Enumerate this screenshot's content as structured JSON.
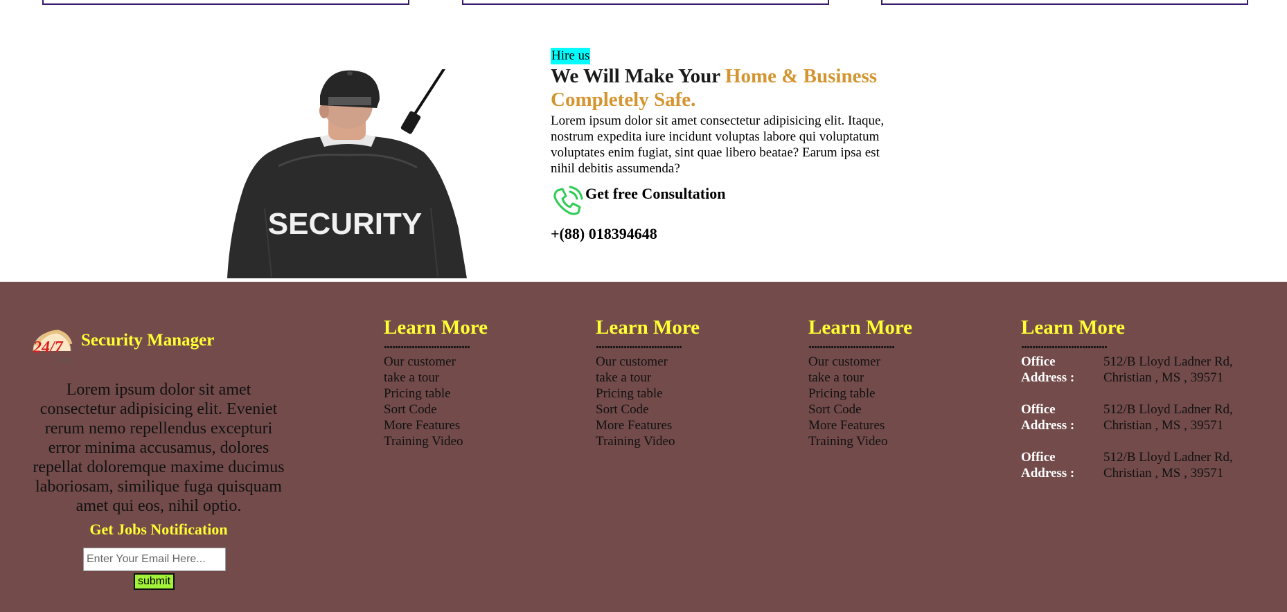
{
  "hire": {
    "tag": "Hire us",
    "title_part1": "We Will Make Your ",
    "title_accent": "Home & Business Completely Safe.",
    "text": "Lorem ipsum dolor sit amet consectetur adipisicing elit. Itaque, nostrum expedita iure incidunt voluptas labore qui voluptatum voluptates enim fugiat, sint quae libero beatae? Earum ipsa est nihil debitis assumenda?",
    "consult_label": "Get free Consultation",
    "phone": "+(88) 018394648",
    "image_text": "SECURITY"
  },
  "footer": {
    "brand_name": "Security Manager",
    "brand_logo_text": "24/7",
    "brand_text": "Lorem ipsum dolor sit amet consectetur adipisicing elit. Eveniet rerum nemo repellendus excepturi error minima accusamus, dolores repellat doloremque maxime ducimus laboriosam, similique fuga quisquam amet qui eos, nihil optio.",
    "jobs_title": "Get Jobs Notification",
    "email_placeholder": "Enter Your Email Here...",
    "submit_label": "submit",
    "columns": [
      {
        "title": "Learn More",
        "dots": "...............................",
        "links": [
          "Our customer",
          "take a tour",
          "Pricing table",
          "Sort Code",
          "More Features",
          "Training Video"
        ]
      },
      {
        "title": "Learn More",
        "dots": "...............................",
        "links": [
          "Our customer",
          "take a tour",
          "Pricing table",
          "Sort Code",
          "More Features",
          "Training Video"
        ]
      },
      {
        "title": "Learn More",
        "dots": "...............................",
        "links": [
          "Our customer",
          "take a tour",
          "Pricing table",
          "Sort Code",
          "More Features",
          "Training Video"
        ]
      }
    ],
    "address_column": {
      "title": "Learn More",
      "dots": "...............................",
      "rows": [
        {
          "label": "Office Address :",
          "value": "512/B Lloyd Ladner Rd, Christian , MS , 39571"
        },
        {
          "label": "Office Address :",
          "value": "512/B Lloyd Ladner Rd, Christian , MS , 39571"
        },
        {
          "label": "Office Address :",
          "value": "512/B Lloyd Ladner Rd, Christian , MS , 39571"
        }
      ]
    }
  },
  "colors": {
    "footer_bg": "#734b4b",
    "heading_yellow": "#ffff33",
    "accent_orange": "#d4942f",
    "tag_cyan": "#00ffff",
    "submit_green": "#a3f23a",
    "phone_green": "#2ecc55",
    "box_border": "#3b1a6b"
  }
}
